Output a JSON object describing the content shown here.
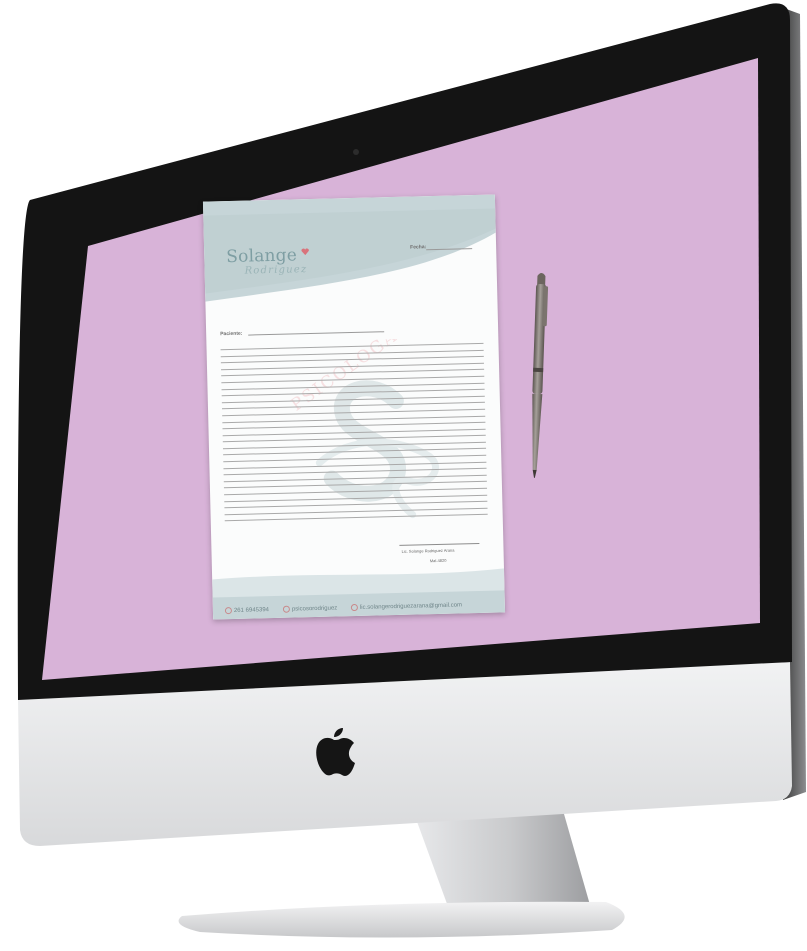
{
  "letterhead": {
    "logo_name": "Solange",
    "logo_surname": "Rodriguez",
    "watermark_text": "PSICOLOGA",
    "date_label": "Fecha:",
    "patient_label": "Paciente:",
    "signature_name": "Lic. Solange Rodriguez Arana",
    "license_number": "Mat.4820",
    "contacts": [
      {
        "icon": "whatsapp-icon",
        "text": "261 6945394"
      },
      {
        "icon": "instagram-icon",
        "text": "psicosorodriguez"
      },
      {
        "icon": "email-icon",
        "text": "lic.solangerodriguezarana@gmail.com"
      }
    ],
    "ruled_lines": 27
  },
  "colors": {
    "screen": "#d8b3d8",
    "paper_band": "#c6d5d8",
    "accent_heart": "#d9737b",
    "bezel": "#141414",
    "chin": "#e3e4e6",
    "apple_logo": "#151515"
  },
  "icons": {
    "brand": "apple-logo-icon",
    "pen": "ballpoint-pen"
  }
}
